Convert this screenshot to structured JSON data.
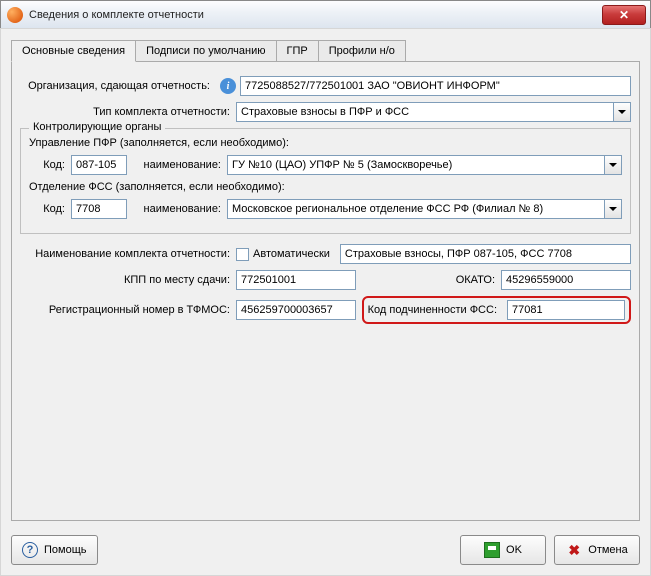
{
  "window": {
    "title": "Сведения о комплекте отчетности"
  },
  "tabs": {
    "t0": "Основные сведения",
    "t1": "Подписи по умолчанию",
    "t2": "ГПР",
    "t3": "Профили н/о"
  },
  "org": {
    "label": "Организация, сдающая отчетность:",
    "value": "7725088527/772501001 ЗАО \"ОВИОНТ ИНФОРМ\""
  },
  "kit_type": {
    "label": "Тип комплекта отчетности:",
    "value": "Страховые взносы в ПФР и ФСС"
  },
  "group": {
    "title": "Контролирующие органы",
    "pfr_hint": "Управление ПФР (заполняется, если необходимо):",
    "fss_hint": "Отделение ФСС (заполняется, если необходимо):",
    "code_label": "Код:",
    "name_label": "наименование:",
    "pfr_code": "087-105",
    "pfr_name": "ГУ №10 (ЦАО) УПФР № 5 (Замоскворечье)",
    "fss_code": "7708",
    "fss_name": "Московское региональное отделение ФСС РФ (Филиал № 8)"
  },
  "kit_name": {
    "label": "Наименование комплекта отчетности:",
    "auto_label": "Автоматически",
    "value": "Страховые взносы, ПФР 087-105, ФСС 7708"
  },
  "kpp": {
    "label": "КПП по месту сдачи:",
    "value": "772501001"
  },
  "okato": {
    "label": "ОКАТО:",
    "value": "45296559000"
  },
  "tfoms": {
    "label": "Регистрационный номер в ТФМОС:",
    "value": "456259700003657"
  },
  "fss_sub": {
    "label": "Код подчиненности ФСС:",
    "value": "77081"
  },
  "buttons": {
    "help": "Помощь",
    "ok": "OK",
    "cancel": "Отмена"
  }
}
